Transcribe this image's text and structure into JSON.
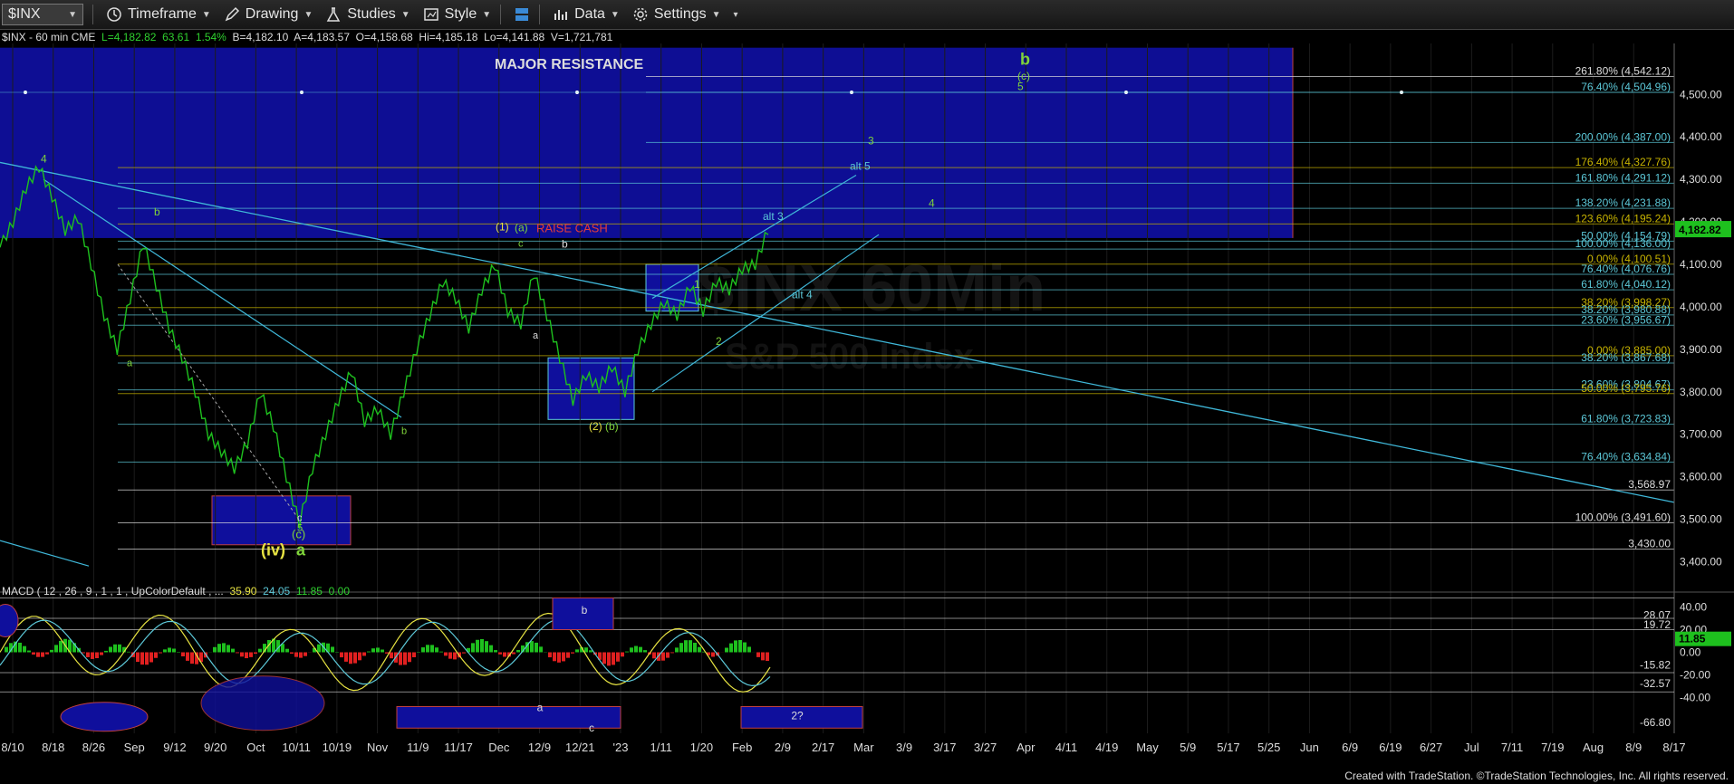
{
  "toolbar": {
    "symbol": "$INX",
    "timeframe": "Timeframe",
    "drawing": "Drawing",
    "studies": "Studies",
    "style": "Style",
    "data": "Data",
    "settings": "Settings"
  },
  "quote": {
    "symbol_line": "$INX - 60 min  CME",
    "last": "L=4,182.82",
    "change": "63.61",
    "pct": "1.54%",
    "bid": "B=4,182.10",
    "ask": "A=4,183.57",
    "open": "O=4,158.68",
    "hi": "Hi=4,185.18",
    "lo": "Lo=4,141.88",
    "vol": "V=1,721,781"
  },
  "macd_header": {
    "label": "MACD ( 12 , 26 , 9 , 1 , 1 , UpColorDefault , ...",
    "v1": "35.90",
    "v2": "24.05",
    "v3": "11.85",
    "v4": "0.00"
  },
  "watermark": {
    "main": "$INX 60Min",
    "sub": "S&P 500 Index"
  },
  "footer": "Created with TradeStation. ©TradeStation Technologies, Inc. All rights reserved.",
  "colors": {
    "price": "#1ec01e",
    "box": "#0f0f9c",
    "trend": "#3fb7d8",
    "fib_yellow": "#c8b400",
    "fib_cyan": "#5cc8d8",
    "wave_green": "#7fd43a",
    "wave_yellow": "#e7e342"
  },
  "chart_data": {
    "type": "line",
    "title": "$INX - 60 min",
    "ylim": [
      3350,
      4620
    ],
    "price_axis_ticks": [
      "4,500.00",
      "4,400.00",
      "4,300.00",
      "4,200.00",
      "4,100.00",
      "4,000.00",
      "3,900.00",
      "3,800.00",
      "3,700.00",
      "3,600.00",
      "3,500.00",
      "3,400.00"
    ],
    "last_price": "4,182.82",
    "x_ticks": [
      "8/10",
      "8/18",
      "8/26",
      "Sep",
      "9/12",
      "9/20",
      "Oct",
      "10/11",
      "10/19",
      "Nov",
      "11/9",
      "11/17",
      "Dec",
      "12/9",
      "12/21",
      "'23",
      "1/11",
      "1/20",
      "Feb",
      "2/9",
      "2/17",
      "Mar",
      "3/9",
      "3/17",
      "3/27",
      "Apr",
      "4/11",
      "4/19",
      "May",
      "5/9",
      "5/17",
      "5/25",
      "Jun",
      "6/9",
      "6/19",
      "6/27",
      "Jul",
      "7/11",
      "7/19",
      "Aug",
      "8/9",
      "8/17"
    ],
    "series": [
      {
        "values": [
          4140,
          4200,
          4280,
          4330,
          4260,
          4180,
          4210,
          4100,
          3980,
          3900,
          4020,
          4150,
          4050,
          3950,
          3880,
          3800,
          3700,
          3660,
          3620,
          3680,
          3800,
          3720,
          3600,
          3490,
          3620,
          3700,
          3780,
          3850,
          3730,
          3760,
          3700,
          3800,
          3900,
          3980,
          4060,
          4020,
          3950,
          4040,
          4100,
          3990,
          3960,
          4080,
          3980,
          3880,
          3780,
          3840,
          3810,
          3860,
          3800,
          3900,
          3960,
          4010,
          3980,
          4050,
          3990,
          4060,
          4040,
          4090,
          4100,
          4183
        ]
      }
    ],
    "fib_levels": [
      {
        "label": "261.80% (4,542.12)",
        "value": 4542.12
      },
      {
        "label": "76.40% (4,504.96)",
        "value": 4504.96
      },
      {
        "label": "200.00% (4,387.00)",
        "value": 4387.0
      },
      {
        "label": "176.40% (4,327.76)",
        "value": 4327.76
      },
      {
        "label": "161.80% (4,291.12)",
        "value": 4291.12
      },
      {
        "label": "138.20% (4,231.88)",
        "value": 4231.88
      },
      {
        "label": "123.60% (4,195.24)",
        "value": 4195.24
      },
      {
        "label": "50.00% (4,154.79)",
        "value": 4154.79
      },
      {
        "label": "100.00% (4,136.00)",
        "value": 4136.0
      },
      {
        "label": "0.00% (4,100.51)",
        "value": 4100.51
      },
      {
        "label": "76.40% (4,076.76)",
        "value": 4076.76
      },
      {
        "label": "61.80% (4,040.12)",
        "value": 4040.12
      },
      {
        "label": "38.20% (3,998.27)",
        "value": 3998.27
      },
      {
        "label": "38.20% (3,980.88)",
        "value": 3980.88
      },
      {
        "label": "23.60% (3,956.67)",
        "value": 3956.67
      },
      {
        "label": "0.00% (3,885.00)",
        "value": 3885.0
      },
      {
        "label": "38.20% (3,867.68)",
        "value": 3867.68
      },
      {
        "label": "23.60% (3,804.67)",
        "value": 3804.67
      },
      {
        "label": "50.00% (3,795.76)",
        "value": 3795.76
      },
      {
        "label": "61.80% (3,723.83)",
        "value": 3723.83
      },
      {
        "label": "76.40% (3,634.84)",
        "value": 3634.84
      },
      {
        "label": "3,568.97",
        "value": 3568.97
      },
      {
        "label": "100.00% (3,491.60)",
        "value": 3491.6
      },
      {
        "label": "3,430.00",
        "value": 3430.0
      }
    ],
    "annotations": [
      "MAJOR RESISTANCE",
      "RAISE CASH",
      "b",
      "(c)",
      "5",
      "3",
      "alt 5",
      "4",
      "alt 3",
      "alt 4",
      "(1)",
      "(a)",
      "c",
      "b",
      "a",
      "1",
      "2",
      "(2)",
      "(b)",
      "(iv)",
      "a",
      "(c)",
      "5",
      "c",
      "4",
      "b",
      "a",
      "b"
    ],
    "macd": {
      "ylim": [
        -70,
        50
      ],
      "axis_ticks": [
        "40.00",
        "20.00",
        "0.00",
        "-20.00",
        "-40.00"
      ],
      "levels": [
        "28.07",
        "19.72",
        "-15.82",
        "-32.57",
        "-66.80"
      ],
      "current": "11.85",
      "annotations": [
        "b",
        "a",
        "c",
        "2?"
      ]
    }
  }
}
